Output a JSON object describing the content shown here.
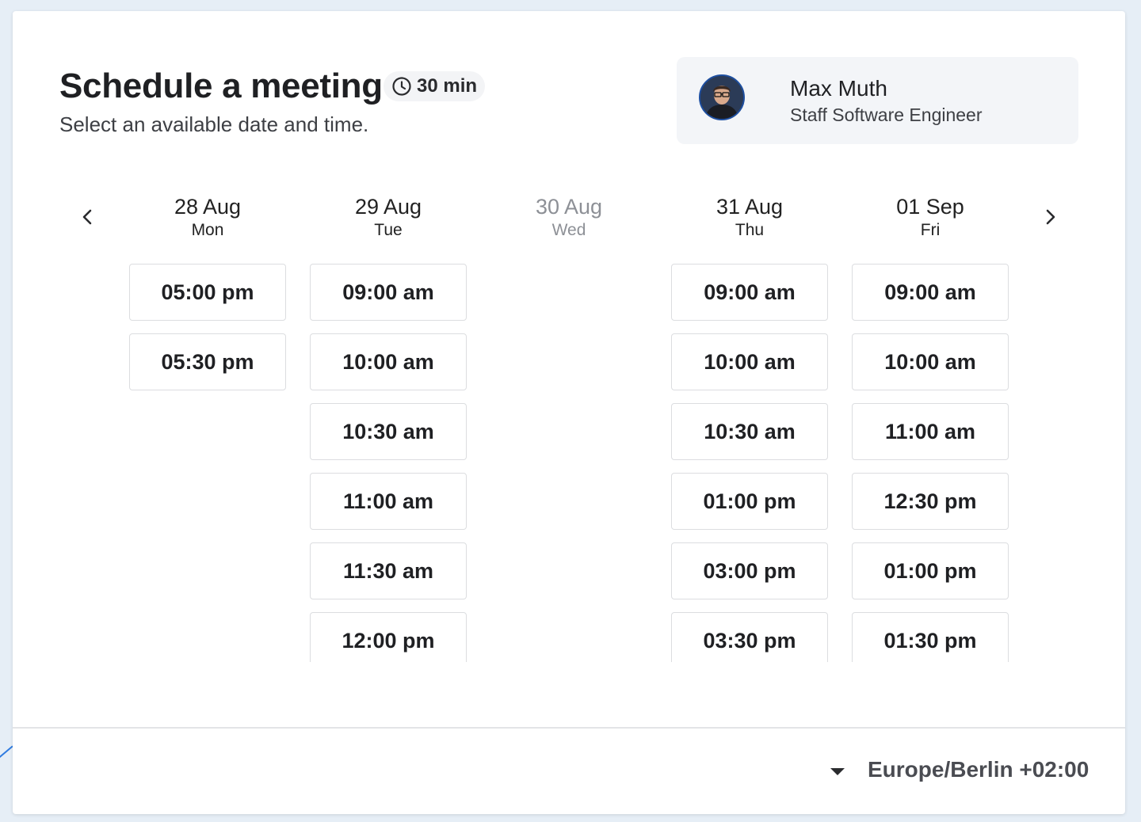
{
  "header": {
    "title": "Schedule a meeting",
    "duration": "30 min",
    "duration_icon": "clock-icon",
    "subtitle": "Select an available date and time."
  },
  "host": {
    "name": "Max Muth",
    "role": "Staff Software Engineer"
  },
  "nav": {
    "prev_icon": "chevron-left-icon",
    "next_icon": "chevron-right-icon"
  },
  "days": [
    {
      "date": "28 Aug",
      "weekday": "Mon",
      "available": true,
      "slots": [
        "05:00 pm",
        "05:30 pm"
      ]
    },
    {
      "date": "29 Aug",
      "weekday": "Tue",
      "available": true,
      "slots": [
        "09:00 am",
        "10:00 am",
        "10:30 am",
        "11:00 am",
        "11:30 am",
        "12:00 pm"
      ]
    },
    {
      "date": "30 Aug",
      "weekday": "Wed",
      "available": false,
      "slots": []
    },
    {
      "date": "31 Aug",
      "weekday": "Thu",
      "available": true,
      "slots": [
        "09:00 am",
        "10:00 am",
        "10:30 am",
        "01:00 pm",
        "03:00 pm",
        "03:30 pm"
      ]
    },
    {
      "date": "01 Sep",
      "weekday": "Fri",
      "available": true,
      "slots": [
        "09:00 am",
        "10:00 am",
        "11:00 am",
        "12:30 pm",
        "01:00 pm",
        "01:30 pm"
      ]
    }
  ],
  "footer": {
    "timezone": "Europe/Berlin +02:00",
    "timezone_icon": "caret-down-icon"
  },
  "colors": {
    "page_background": "#e6eef6",
    "card_background": "#ffffff",
    "chip_background": "#f3f4f6",
    "host_background": "#f3f5f8",
    "disabled_text": "#8d9096"
  }
}
